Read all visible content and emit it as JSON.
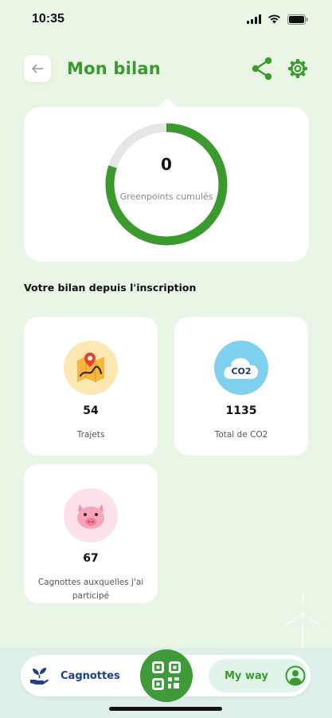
{
  "status_bar": {
    "time": "10:35"
  },
  "header": {
    "title": "Mon bilan"
  },
  "score": {
    "value": "0",
    "label": "Greenpoints cumulés",
    "progress_fraction": 0.8
  },
  "section_title": "Votre bilan depuis l'inscription",
  "stats": [
    {
      "value": "54",
      "label": "Trajets",
      "icon": "map-pin-route-icon"
    },
    {
      "value": "1135",
      "label": "Total de CO2",
      "icon": "co2-cloud-icon",
      "icon_text": "CO2"
    },
    {
      "value": "67",
      "label": "Cagnottes auxquelles j'ai participé",
      "icon": "piggy-bank-icon"
    }
  ],
  "bottom_nav": {
    "cagnottes_label": "Cagnottes",
    "myway_label": "My way"
  },
  "colors": {
    "brand_green": "#3a9a2e",
    "nav_blue": "#1f3d8a",
    "ring_track": "#e6e6e6",
    "background": "#e9f6e6"
  }
}
